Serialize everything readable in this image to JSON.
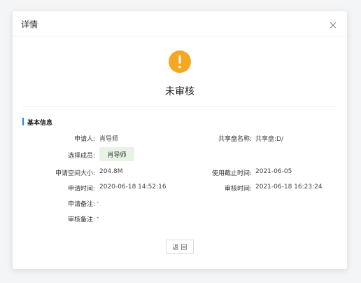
{
  "dialog": {
    "title": "详情",
    "status": "未审核",
    "back_label": "返 回"
  },
  "section": {
    "title": "基本信息"
  },
  "fields": {
    "applicant": {
      "label": "申请人:",
      "value": "肖导师"
    },
    "share_name": {
      "label": "共享盘名称:",
      "value": "共享盘:D/"
    },
    "members": {
      "label": "选择成员:",
      "value": "肖导师"
    },
    "space_size": {
      "label": "申请空间大小:",
      "value": "204.8M"
    },
    "deadline": {
      "label": "使用截止时间:",
      "value": "2021-06-05"
    },
    "apply_time": {
      "label": "申请时间:",
      "value": "2020-06-18 14:52:16"
    },
    "review_time": {
      "label": "审核时间:",
      "value": "2021-06-18 16:23:24"
    },
    "apply_note": {
      "label": "申请备注:",
      "value": "-"
    },
    "review_note": {
      "label": "审核备注:",
      "value": "-"
    }
  },
  "colors": {
    "warning": "#f5a623",
    "accent": "#1e88e5",
    "chip_bg": "#e7f4e5"
  },
  "icons": {
    "close": "close-icon",
    "status": "warning-icon"
  }
}
